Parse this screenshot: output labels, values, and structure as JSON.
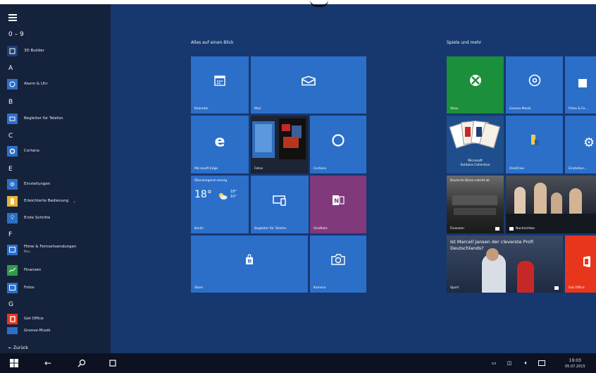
{
  "colors": {
    "desktop": "#17376f",
    "tile": "#2c6fc9",
    "xbox": "#1b8f3c",
    "onenote": "#80397b",
    "office": "#e8361d",
    "sidebar": "#15223b",
    "taskbar": "#0c1221"
  },
  "left": {
    "sections": {
      "hash": "0 – 9",
      "a": "A",
      "b": "B",
      "c": "C",
      "e": "E",
      "f": "F",
      "g": "G"
    },
    "apps": [
      {
        "label": "3D Builder",
        "icon": "cube-icon"
      },
      {
        "label": "Alarm & Uhr",
        "icon": "alarm-icon"
      },
      {
        "label": "Begleiter für Telefon",
        "icon": "phone-icon"
      },
      {
        "label": "Cortana",
        "icon": "cortana-icon"
      },
      {
        "label": "Einstellungen",
        "icon": "gear-icon"
      },
      {
        "label": "Erleichterte Bedienung",
        "icon": "accessibility-icon"
      },
      {
        "label": "Erste Schritte",
        "icon": "lightbulb-icon"
      },
      {
        "label": "Filme & Fernsehsendungen",
        "sub": "Neu",
        "icon": "film-icon"
      },
      {
        "label": "Finanzen",
        "icon": "chart-icon"
      },
      {
        "label": "Fotos",
        "icon": "photo-icon"
      },
      {
        "label": "Get Office",
        "icon": "office-icon"
      },
      {
        "label": "Groove-Musik",
        "icon": "music-icon"
      }
    ],
    "back": "← Zurück"
  },
  "groups": {
    "left": "Alles auf einen Blick",
    "right": "Spiele und mehr"
  },
  "tiles": {
    "kalender": "Kalender",
    "mail": "Mail",
    "edge": "Microsoft Edge",
    "fotos": "Fotos",
    "cortana": "Cortana",
    "weather_top": "Überwiegend sonnig",
    "weather_temp": "18°",
    "weather_hi": "18°",
    "weather_lo": "10°",
    "weather_city": "Berlin",
    "phone": "Begleiter für Telefon",
    "onenote": "OneNote",
    "store": "Store",
    "camera": "Kamera",
    "xbox": "Xbox",
    "groove": "Groove-Musik",
    "films": "Filme & Fe...",
    "solitaire1": "Microsoft",
    "solitaire2": "Solitaire Collection",
    "onedrive": "OneDrive",
    "settings": "Einstellun...",
    "finance_head": "Deutsche Börse rutscht ab",
    "finance": "Finanzen",
    "news": "Nachrichten",
    "sport_head": "Ist Marcell Jansen der cleverste Profi Deutschlands?",
    "sport": "Sport",
    "office": "Get Office"
  },
  "tray": {
    "time": "19:03",
    "date": "05.07.2015"
  }
}
